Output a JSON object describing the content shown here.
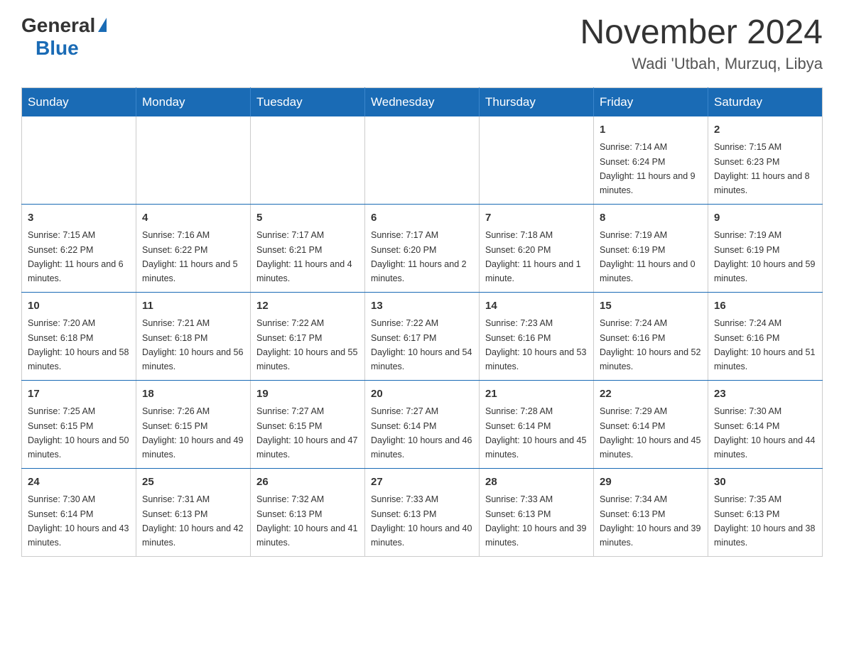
{
  "logo": {
    "general": "General",
    "blue": "Blue"
  },
  "header": {
    "month_year": "November 2024",
    "location": "Wadi 'Utbah, Murzuq, Libya"
  },
  "days_of_week": [
    "Sunday",
    "Monday",
    "Tuesday",
    "Wednesday",
    "Thursday",
    "Friday",
    "Saturday"
  ],
  "weeks": [
    [
      {
        "day": "",
        "info": ""
      },
      {
        "day": "",
        "info": ""
      },
      {
        "day": "",
        "info": ""
      },
      {
        "day": "",
        "info": ""
      },
      {
        "day": "",
        "info": ""
      },
      {
        "day": "1",
        "info": "Sunrise: 7:14 AM\nSunset: 6:24 PM\nDaylight: 11 hours and 9 minutes."
      },
      {
        "day": "2",
        "info": "Sunrise: 7:15 AM\nSunset: 6:23 PM\nDaylight: 11 hours and 8 minutes."
      }
    ],
    [
      {
        "day": "3",
        "info": "Sunrise: 7:15 AM\nSunset: 6:22 PM\nDaylight: 11 hours and 6 minutes."
      },
      {
        "day": "4",
        "info": "Sunrise: 7:16 AM\nSunset: 6:22 PM\nDaylight: 11 hours and 5 minutes."
      },
      {
        "day": "5",
        "info": "Sunrise: 7:17 AM\nSunset: 6:21 PM\nDaylight: 11 hours and 4 minutes."
      },
      {
        "day": "6",
        "info": "Sunrise: 7:17 AM\nSunset: 6:20 PM\nDaylight: 11 hours and 2 minutes."
      },
      {
        "day": "7",
        "info": "Sunrise: 7:18 AM\nSunset: 6:20 PM\nDaylight: 11 hours and 1 minute."
      },
      {
        "day": "8",
        "info": "Sunrise: 7:19 AM\nSunset: 6:19 PM\nDaylight: 11 hours and 0 minutes."
      },
      {
        "day": "9",
        "info": "Sunrise: 7:19 AM\nSunset: 6:19 PM\nDaylight: 10 hours and 59 minutes."
      }
    ],
    [
      {
        "day": "10",
        "info": "Sunrise: 7:20 AM\nSunset: 6:18 PM\nDaylight: 10 hours and 58 minutes."
      },
      {
        "day": "11",
        "info": "Sunrise: 7:21 AM\nSunset: 6:18 PM\nDaylight: 10 hours and 56 minutes."
      },
      {
        "day": "12",
        "info": "Sunrise: 7:22 AM\nSunset: 6:17 PM\nDaylight: 10 hours and 55 minutes."
      },
      {
        "day": "13",
        "info": "Sunrise: 7:22 AM\nSunset: 6:17 PM\nDaylight: 10 hours and 54 minutes."
      },
      {
        "day": "14",
        "info": "Sunrise: 7:23 AM\nSunset: 6:16 PM\nDaylight: 10 hours and 53 minutes."
      },
      {
        "day": "15",
        "info": "Sunrise: 7:24 AM\nSunset: 6:16 PM\nDaylight: 10 hours and 52 minutes."
      },
      {
        "day": "16",
        "info": "Sunrise: 7:24 AM\nSunset: 6:16 PM\nDaylight: 10 hours and 51 minutes."
      }
    ],
    [
      {
        "day": "17",
        "info": "Sunrise: 7:25 AM\nSunset: 6:15 PM\nDaylight: 10 hours and 50 minutes."
      },
      {
        "day": "18",
        "info": "Sunrise: 7:26 AM\nSunset: 6:15 PM\nDaylight: 10 hours and 49 minutes."
      },
      {
        "day": "19",
        "info": "Sunrise: 7:27 AM\nSunset: 6:15 PM\nDaylight: 10 hours and 47 minutes."
      },
      {
        "day": "20",
        "info": "Sunrise: 7:27 AM\nSunset: 6:14 PM\nDaylight: 10 hours and 46 minutes."
      },
      {
        "day": "21",
        "info": "Sunrise: 7:28 AM\nSunset: 6:14 PM\nDaylight: 10 hours and 45 minutes."
      },
      {
        "day": "22",
        "info": "Sunrise: 7:29 AM\nSunset: 6:14 PM\nDaylight: 10 hours and 45 minutes."
      },
      {
        "day": "23",
        "info": "Sunrise: 7:30 AM\nSunset: 6:14 PM\nDaylight: 10 hours and 44 minutes."
      }
    ],
    [
      {
        "day": "24",
        "info": "Sunrise: 7:30 AM\nSunset: 6:14 PM\nDaylight: 10 hours and 43 minutes."
      },
      {
        "day": "25",
        "info": "Sunrise: 7:31 AM\nSunset: 6:13 PM\nDaylight: 10 hours and 42 minutes."
      },
      {
        "day": "26",
        "info": "Sunrise: 7:32 AM\nSunset: 6:13 PM\nDaylight: 10 hours and 41 minutes."
      },
      {
        "day": "27",
        "info": "Sunrise: 7:33 AM\nSunset: 6:13 PM\nDaylight: 10 hours and 40 minutes."
      },
      {
        "day": "28",
        "info": "Sunrise: 7:33 AM\nSunset: 6:13 PM\nDaylight: 10 hours and 39 minutes."
      },
      {
        "day": "29",
        "info": "Sunrise: 7:34 AM\nSunset: 6:13 PM\nDaylight: 10 hours and 39 minutes."
      },
      {
        "day": "30",
        "info": "Sunrise: 7:35 AM\nSunset: 6:13 PM\nDaylight: 10 hours and 38 minutes."
      }
    ]
  ]
}
